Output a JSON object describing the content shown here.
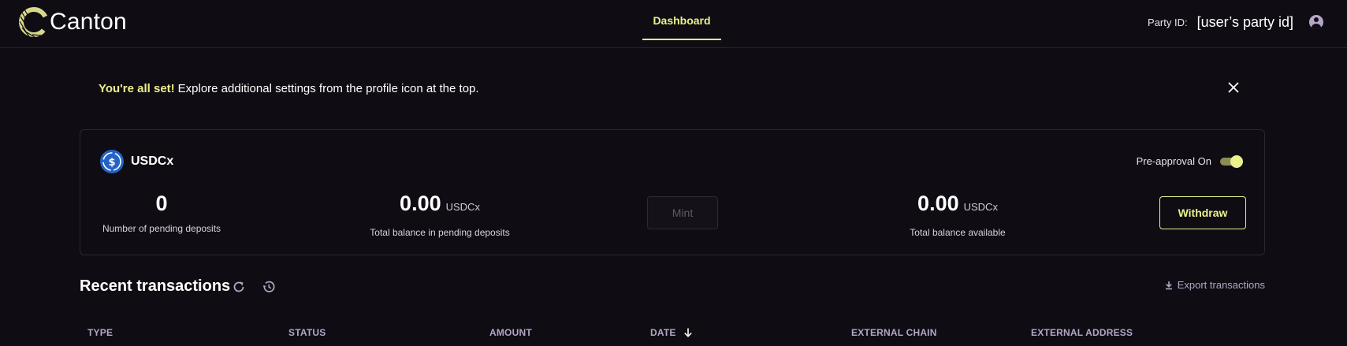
{
  "header": {
    "brand": "Canton",
    "nav_tab": "Dashboard",
    "party_label": "Party ID:",
    "party_value": "[user’s party id]"
  },
  "banner": {
    "strong": "You're all set!",
    "message": "Explore additional settings from the profile icon at the top."
  },
  "card": {
    "token_name": "USDCx",
    "preapproval_label": "Pre-approval On",
    "preapproval_on": true,
    "pending_count": "0",
    "pending_count_label": "Number of pending deposits",
    "pending_balance": "0.00",
    "pending_balance_unit": "USDCx",
    "pending_balance_label": "Total balance in pending deposits",
    "mint_label": "Mint",
    "available_balance": "0.00",
    "available_balance_unit": "USDCx",
    "available_balance_label": "Total balance available",
    "withdraw_label": "Withdraw"
  },
  "transactions": {
    "title": "Recent transactions",
    "export_label": "Export transactions",
    "columns": [
      "TYPE",
      "STATUS",
      "AMOUNT",
      "DATE",
      "EXTERNAL CHAIN",
      "EXTERNAL ADDRESS"
    ]
  },
  "colors": {
    "accent": "#ecf08d",
    "background": "#0f0d13",
    "muted": "#b4a5c6",
    "token_blue": "#2362c6"
  },
  "icons": [
    "canton-logo-icon",
    "profile-icon",
    "close-icon",
    "usdc-coin-icon",
    "refresh-icon",
    "history-icon",
    "download-icon",
    "arrow-down-icon"
  ]
}
